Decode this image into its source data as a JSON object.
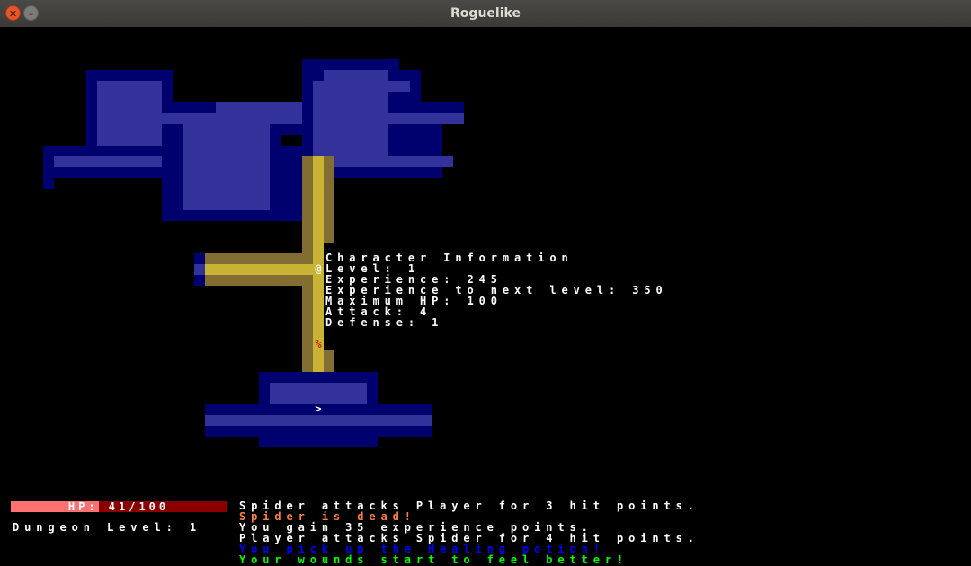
{
  "window": {
    "title": "Roguelike"
  },
  "colors": {
    "dark_wall": "#00006e",
    "dark_ground": "#32329a",
    "light_wall": "#826e32",
    "light_ground": "#c8b432",
    "hp_fill": "#ff7070",
    "hp_back": "#8a0000",
    "background": "#000000"
  },
  "map": {
    "player_glyph": "@",
    "corpse_glyph": "%",
    "stairs_glyph": ">"
  },
  "character_info": {
    "heading": "Character Information",
    "level": "Level: 1",
    "experience": "Experience: 245",
    "experience_next": "Experience to next level: 350",
    "max_hp": "Maximum HP: 100",
    "attack": "Attack: 4",
    "defense": "Defense: 1"
  },
  "status": {
    "hp_label": "HP: 41/100",
    "hp_current": 41,
    "hp_max": 100,
    "dungeon_level": "Dungeon Level: 1"
  },
  "messages": [
    {
      "text": "Spider attacks Player for 3 hit points.",
      "color": "#ffffff"
    },
    {
      "text": "Spider is dead!",
      "color": "#ff7f3f"
    },
    {
      "text": "You gain 35 experience points.",
      "color": "#ffffff"
    },
    {
      "text": "Player attacks Spider for 4 hit points.",
      "color": "#ffffff"
    },
    {
      "text": "You pick up the Healing potion!",
      "color": "#0000ff"
    },
    {
      "text": "Your wounds start to feel better!",
      "color": "#00ff00"
    }
  ]
}
